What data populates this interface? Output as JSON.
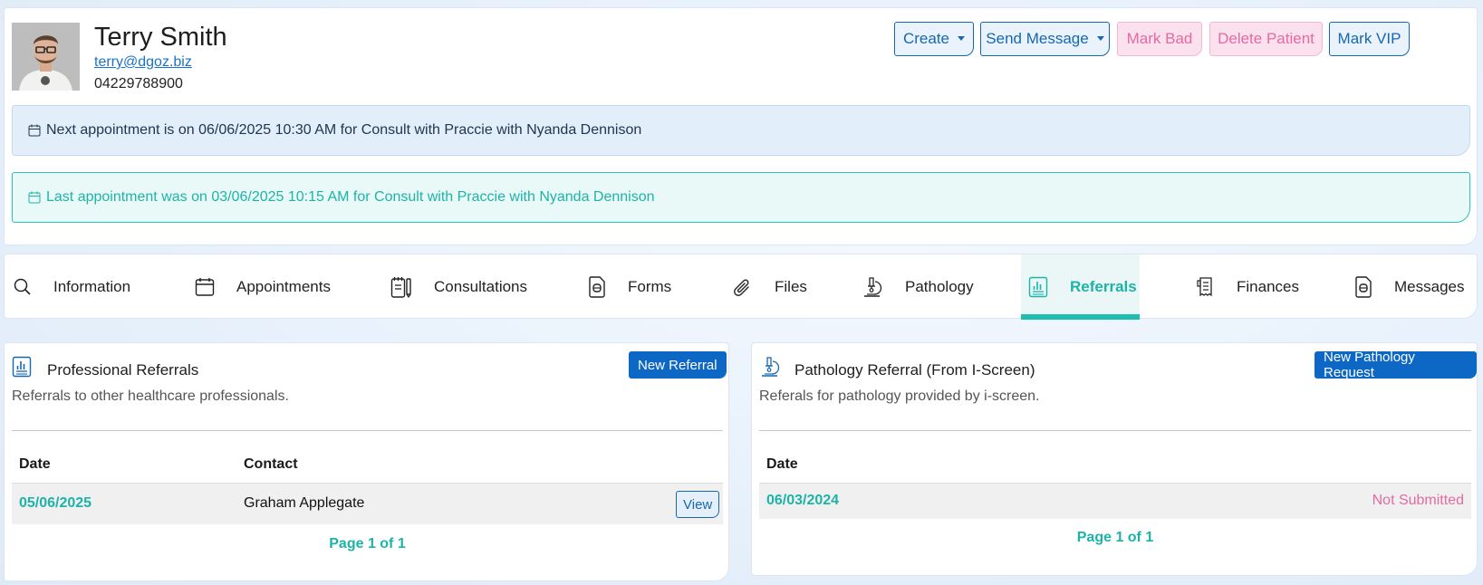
{
  "patient": {
    "name": "Terry Smith",
    "email": "terry@dgoz.biz",
    "phone": "04229788900"
  },
  "actions": {
    "create": "Create",
    "send_message": "Send Message",
    "mark_bad": "Mark Bad",
    "delete_patient": "Delete Patient",
    "mark_vip": "Mark VIP"
  },
  "alerts": {
    "next": "Next appointment is on 06/06/2025 10:30 AM for Consult with Praccie with Nyanda Dennison",
    "last": "Last appointment was on 03/06/2025 10:15 AM for Consult with Praccie with Nyanda Dennison"
  },
  "tabs": [
    {
      "label": "Information",
      "icon": "search-icon"
    },
    {
      "label": "Appointments",
      "icon": "calendar-icon"
    },
    {
      "label": "Consultations",
      "icon": "clipboard-icon"
    },
    {
      "label": "Forms",
      "icon": "document-icon"
    },
    {
      "label": "Files",
      "icon": "paperclip-icon"
    },
    {
      "label": "Pathology",
      "icon": "microscope-icon"
    },
    {
      "label": "Referrals",
      "icon": "chart-document-icon",
      "active": true
    },
    {
      "label": "Finances",
      "icon": "receipt-icon"
    },
    {
      "label": "Messages",
      "icon": "message-document-icon"
    }
  ],
  "professional": {
    "title": "Professional Referrals",
    "subtitle": "Referrals to other healthcare professionals.",
    "new_button": "New Referral",
    "columns": [
      "Date",
      "Contact"
    ],
    "rows": [
      {
        "date": "05/06/2025",
        "contact": "Graham Applegate",
        "action": "View"
      }
    ],
    "pager": "Page 1 of 1"
  },
  "pathology": {
    "title": "Pathology Referral (From I-Screen)",
    "subtitle": "Referals for pathology provided by i-screen.",
    "new_button": "New Pathology Request",
    "columns": [
      "Date"
    ],
    "rows": [
      {
        "date": "06/03/2024",
        "status": "Not Submitted"
      }
    ],
    "pager": "Page 1 of 1"
  },
  "colors": {
    "accent_teal": "#1db3a8",
    "primary_blue": "#0c68c4",
    "pink_status": "#e46aa1"
  }
}
